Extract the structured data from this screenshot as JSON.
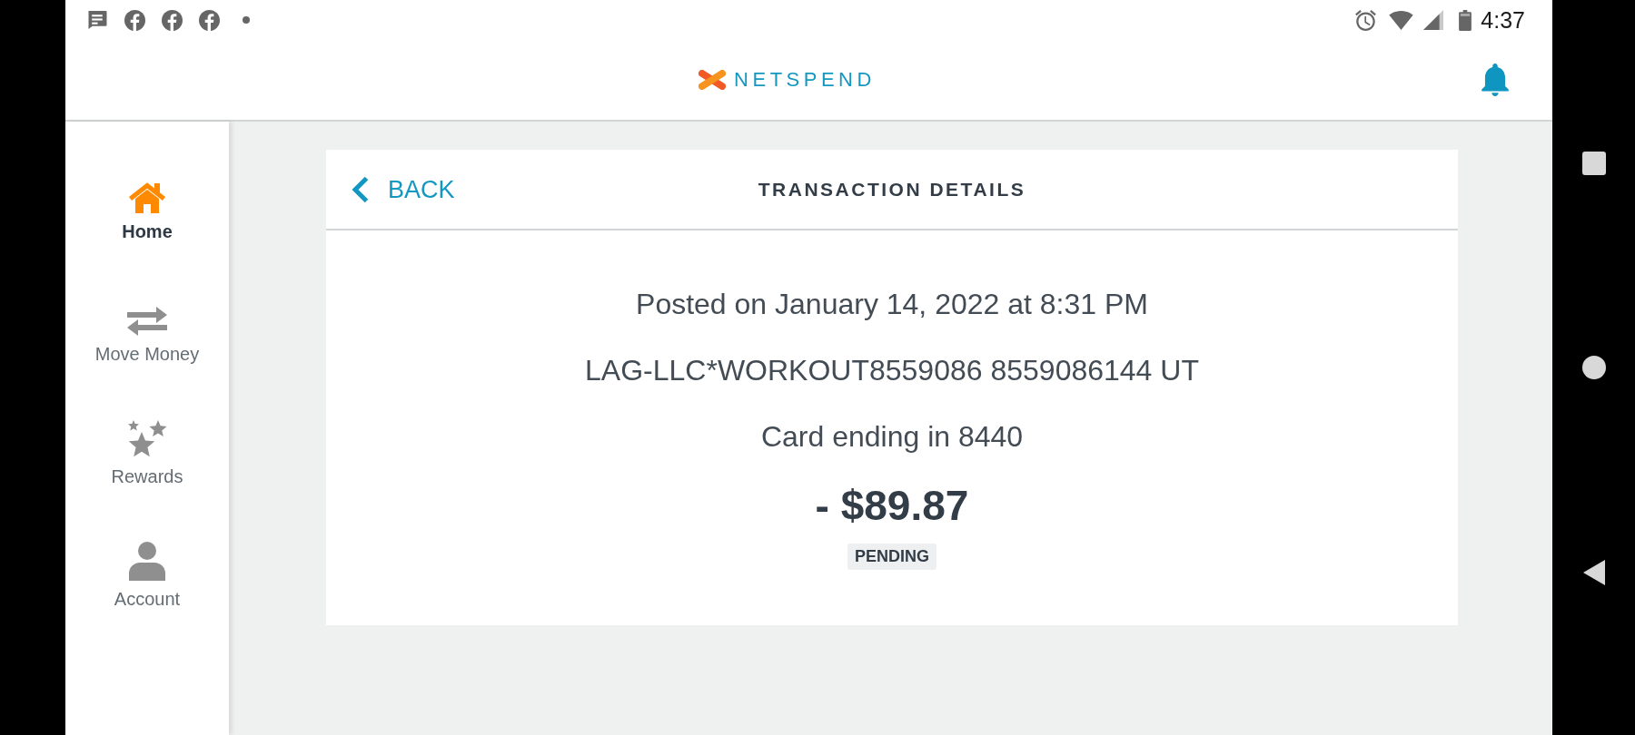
{
  "status_bar": {
    "time": "4:37"
  },
  "header": {
    "logo_text": "NETSPEND"
  },
  "sidebar": {
    "items": [
      {
        "label": "Home",
        "selected": true
      },
      {
        "label": "Move Money",
        "selected": false
      },
      {
        "label": "Rewards",
        "selected": false
      },
      {
        "label": "Account",
        "selected": false
      }
    ]
  },
  "transaction_card": {
    "back_button": "BACK",
    "title": "TRANSACTION DETAILS",
    "posted": "Posted on January 14, 2022 at 8:31 PM",
    "merchant": "LAG-LLC*WORKOUT8559086 8559086144 UT",
    "card": "Card ending in 8440",
    "amount": "- $89.87",
    "status": "PENDING"
  }
}
